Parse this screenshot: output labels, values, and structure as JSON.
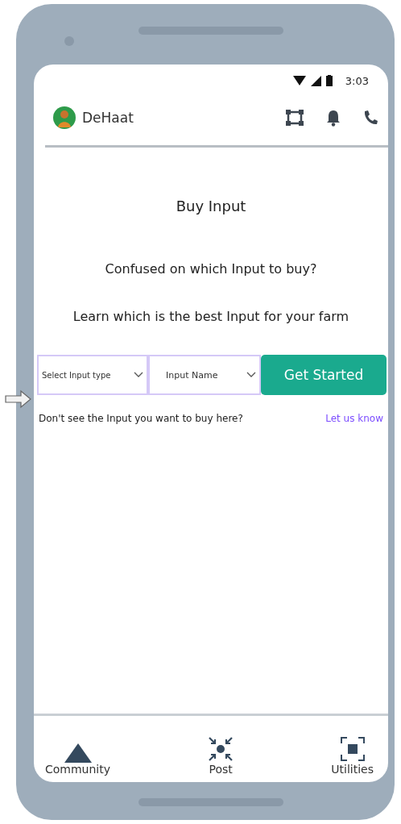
{
  "status_bar": {
    "time": "3:03"
  },
  "header": {
    "app_name": "DeHaat"
  },
  "page": {
    "title": "Buy Input",
    "question": "Confused on which Input to buy?",
    "subtitle": "Learn which is the best Input for your farm"
  },
  "form": {
    "input_type": {
      "placeholder": "Select Input type"
    },
    "input_name": {
      "placeholder": "Input Name"
    },
    "button": "Get Started"
  },
  "help": {
    "text": "Don't see the Input you want to buy here?",
    "link": "Let us know"
  },
  "bottom_nav": [
    {
      "kind": "community",
      "label": "Community"
    },
    {
      "kind": "post",
      "label": "Post"
    },
    {
      "kind": "utilities",
      "label": "Utilities"
    }
  ]
}
